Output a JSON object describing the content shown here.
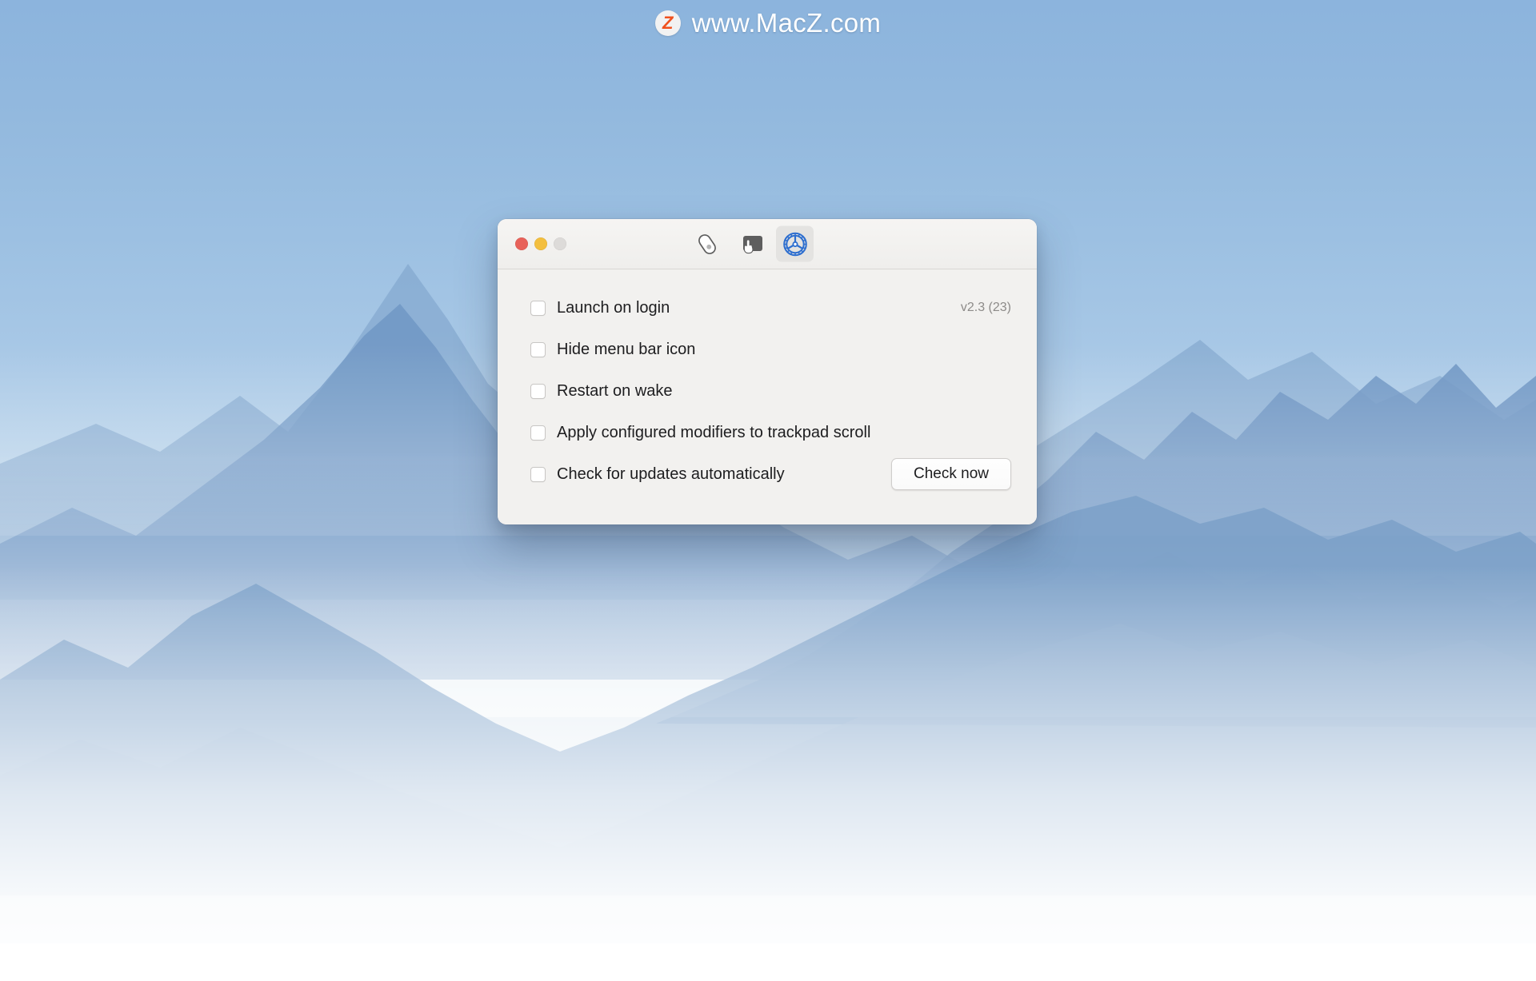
{
  "watermark": {
    "badge_letter": "Z",
    "text": "www.MacZ.com",
    "badge_color": "#f0511e"
  },
  "window": {
    "traffic_lights": [
      {
        "name": "close",
        "color": "#e8625a"
      },
      {
        "name": "minimize",
        "color": "#f3bf3f"
      },
      {
        "name": "zoom",
        "color": "#dddbd9"
      }
    ],
    "toolbar": {
      "items": [
        {
          "icon": "mouse-icon",
          "label": "Mouse",
          "selected": false
        },
        {
          "icon": "trackpad-icon",
          "label": "Trackpad",
          "selected": false
        },
        {
          "icon": "gear-icon",
          "label": "Settings",
          "selected": true
        }
      ],
      "accent_color": "#2d6ecf"
    },
    "settings": {
      "rows": [
        {
          "label": "Launch on login",
          "checked": false
        },
        {
          "label": "Hide menu bar icon",
          "checked": false
        },
        {
          "label": "Restart on wake",
          "checked": false
        },
        {
          "label": "Apply configured modifiers to trackpad scroll",
          "checked": false
        },
        {
          "label": "Check for updates automatically",
          "checked": false
        }
      ],
      "version": "v2.3 (23)",
      "check_now_label": "Check now"
    }
  }
}
